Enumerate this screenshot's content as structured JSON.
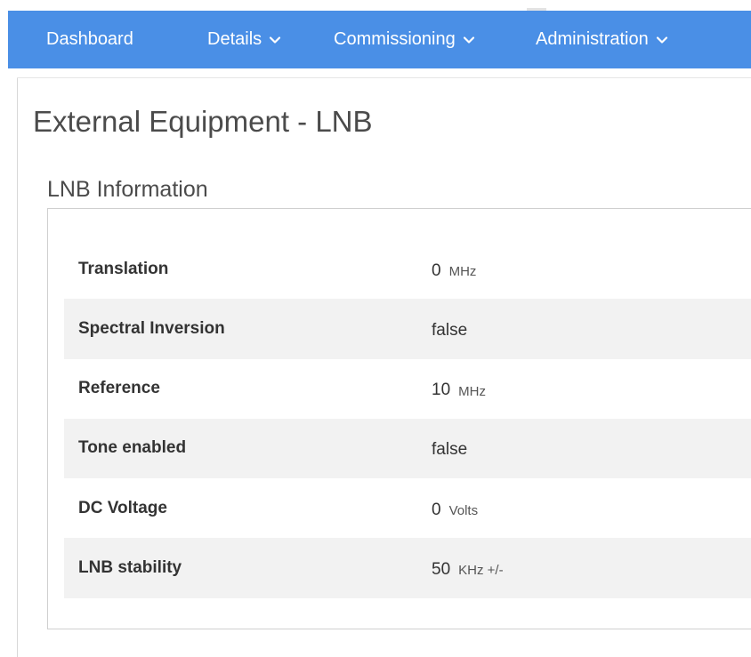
{
  "nav": {
    "items": [
      {
        "label": "Dashboard",
        "has_dropdown": false
      },
      {
        "label": "Details",
        "has_dropdown": true
      },
      {
        "label": "Commissioning",
        "has_dropdown": true
      },
      {
        "label": "Administration",
        "has_dropdown": true
      }
    ],
    "colors": {
      "background": "#4a8fe6",
      "text": "#ffffff"
    }
  },
  "page": {
    "title": "External Equipment - LNB"
  },
  "section": {
    "title": "LNB Information"
  },
  "lnb_info": {
    "rows": [
      {
        "label": "Translation",
        "value": "0",
        "unit": "MHz"
      },
      {
        "label": "Spectral Inversion",
        "value": "false",
        "unit": ""
      },
      {
        "label": "Reference",
        "value": "10",
        "unit": "MHz"
      },
      {
        "label": "Tone enabled",
        "value": "false",
        "unit": ""
      },
      {
        "label": "DC Voltage",
        "value": "0",
        "unit": "Volts"
      },
      {
        "label": "LNB stability",
        "value": "50",
        "unit": "KHz +/-"
      }
    ],
    "colors": {
      "shaded_row": "#f2f2f2"
    }
  }
}
